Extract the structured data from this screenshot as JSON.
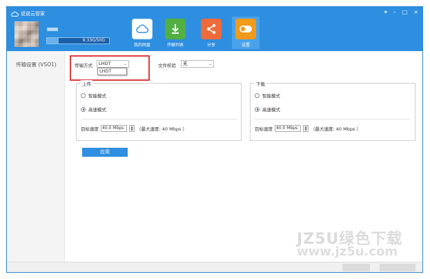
{
  "app": {
    "title": "说说云管家"
  },
  "window_controls": {
    "dropdown": "▾",
    "minimize": "–",
    "restore": "□",
    "close": "×"
  },
  "user": {
    "quota": "9.33G/50G",
    "quota_fraction": 0.19
  },
  "nav": [
    {
      "label": "我的网盘",
      "icon": "cloud-drive-icon",
      "color": "#2e8ee0"
    },
    {
      "label": "传输列表",
      "icon": "transfer-arrows-icon",
      "color": "#52b043"
    },
    {
      "label": "分享",
      "icon": "share-icon",
      "color": "#ef6a3a"
    },
    {
      "label": "设置",
      "icon": "settings-toggle-icon",
      "color": "#f29a1a"
    }
  ],
  "sidebar": {
    "items": [
      {
        "label": "传输设置 (VSO1)"
      }
    ]
  },
  "settings": {
    "transfer_mode_label": "传输方式",
    "transfer_mode_value": "LHDT",
    "transfer_mode_options": [
      "LHDT"
    ],
    "file_check_label": "文件校验",
    "file_check_value": "无",
    "upload": {
      "title": "上传",
      "smart_mode": "智能模式",
      "fast_mode": "高速模式",
      "selected": "fast",
      "speed_label": "目标速度",
      "speed_value": "40.0 Mbps",
      "max_speed": "（最大速度: 40 Mbps ）"
    },
    "download": {
      "title": "下载",
      "smart_mode": "智能模式",
      "fast_mode": "高速模式",
      "selected": "fast",
      "speed_label": "目标速度",
      "speed_value": "40.0 Mbps",
      "max_speed": "（最大速度: 40 Mbps ）"
    },
    "apply_label": "应用"
  },
  "watermark": {
    "line1": "JZ5U绿色下载",
    "line2": "www.jz5u.com"
  }
}
